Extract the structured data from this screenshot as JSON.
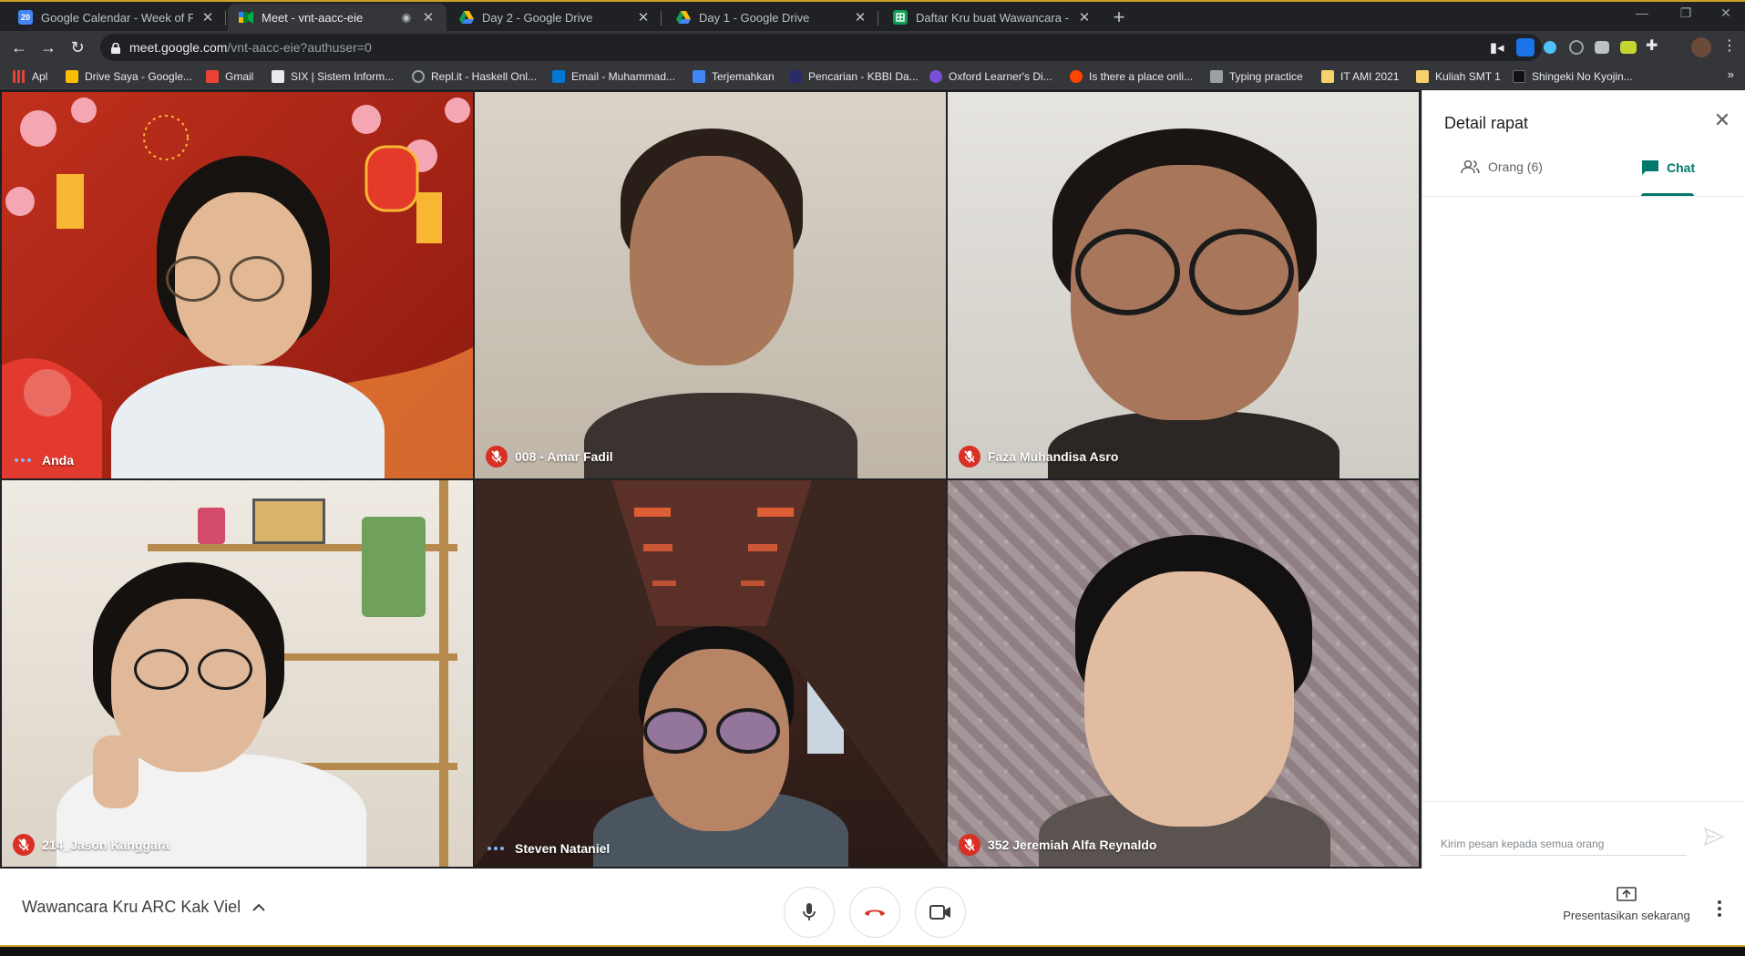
{
  "browser": {
    "tabs": [
      {
        "title": "Google Calendar - Week of Febru",
        "icon": "calendar-icon",
        "color": "#4285f4",
        "badge": "20",
        "active": false
      },
      {
        "title": "Meet - vnt-aacc-eie",
        "icon": "meet-icon",
        "color": "#00832d",
        "badge": "",
        "active": true
      },
      {
        "title": "Day 2 - Google Drive",
        "icon": "drive-icon",
        "color": "#fbbc04",
        "badge": "",
        "active": false
      },
      {
        "title": "Day 1 - Google Drive",
        "icon": "drive-icon",
        "color": "#fbbc04",
        "badge": "",
        "active": false
      },
      {
        "title": "Daftar Kru buat Wawancara - Go",
        "icon": "sheets-icon",
        "color": "#0f9d58",
        "badge": "",
        "active": false
      }
    ],
    "url_host": "meet.google.com",
    "url_path": "/vnt-aacc-eie?authuser=0",
    "bookmarks": [
      {
        "label": "Apl",
        "icon": "apps-grid-icon",
        "color": "#e94235"
      },
      {
        "label": "Drive Saya - Google...",
        "icon": "drive-icon",
        "color": "#fbbc04"
      },
      {
        "label": "Gmail",
        "icon": "gmail-icon",
        "color": "#ea4335"
      },
      {
        "label": "SIX | Sistem Inform...",
        "icon": "six-icon",
        "color": "#e8eaed"
      },
      {
        "label": "Repl.it - Haskell Onl...",
        "icon": "replit-icon",
        "color": "#9aa0a6"
      },
      {
        "label": "Email - Muhammad...",
        "icon": "outlook-icon",
        "color": "#0078d4"
      },
      {
        "label": "Terjemahkan",
        "icon": "translate-icon",
        "color": "#4285f4"
      },
      {
        "label": "Pencarian - KBBI Da...",
        "icon": "kbbi-icon",
        "color": "#2b2b6b"
      },
      {
        "label": "Oxford Learner's Di...",
        "icon": "oxford-icon",
        "color": "#7b4fd6"
      },
      {
        "label": "Is there a place onli...",
        "icon": "reddit-icon",
        "color": "#ff4500"
      },
      {
        "label": "Typing practice",
        "icon": "page-icon",
        "color": "#9aa0a6"
      },
      {
        "label": "IT AMI 2021",
        "icon": "folder-icon",
        "color": "#f5d26b"
      },
      {
        "label": "Kuliah SMT 1",
        "icon": "folder-icon",
        "color": "#f5d26b"
      },
      {
        "label": "Shingeki No Kyojin...",
        "icon": "mc-icon",
        "color": "#111111"
      }
    ],
    "more_label": "»"
  },
  "participants": [
    {
      "name": "Anda",
      "status": "speaking",
      "bg": "#b22a1a"
    },
    {
      "name": "008 - Amar Fadil",
      "status": "muted",
      "bg": "#cfc8bd"
    },
    {
      "name": "Faza Muhandisa Asro",
      "status": "muted",
      "bg": "#d9d7d2"
    },
    {
      "name": "214_Jason Kanggara",
      "status": "muted",
      "bg": "#e8e3db"
    },
    {
      "name": "Steven Nataniel",
      "status": "speaking",
      "bg": "#3a2420"
    },
    {
      "name": "352 Jeremiah Alfa Reynaldo",
      "status": "muted",
      "bg": "#9a8a8c"
    }
  ],
  "panel": {
    "title": "Detail rapat",
    "tab_people": "Orang (6)",
    "tab_chat": "Chat",
    "message_placeholder": "Kirim pesan kepada semua orang"
  },
  "bottom": {
    "meeting_title": "Wawancara Kru ARC Kak Viel",
    "present_label": "Presentasikan sekarang"
  },
  "colors": {
    "accent": "#00796b",
    "hangup": "#d93025",
    "speaking": "#8ab4f8"
  }
}
